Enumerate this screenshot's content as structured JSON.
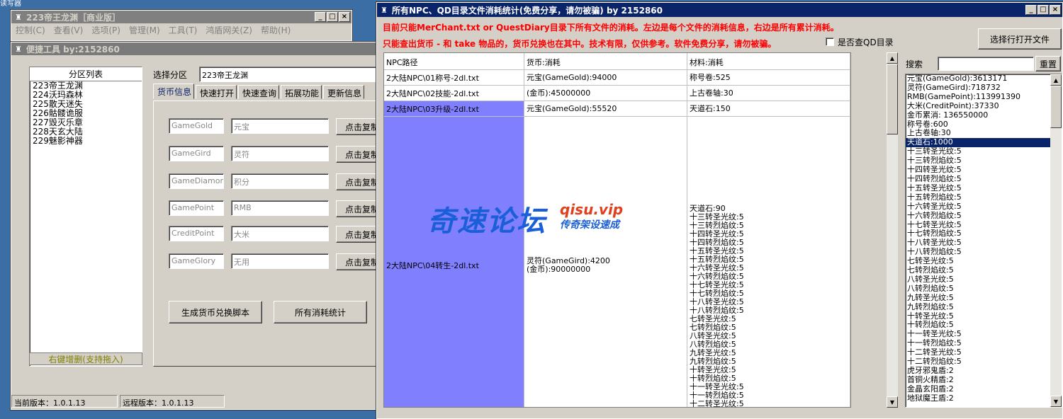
{
  "desktop": {
    "corner_text": "读写器"
  },
  "main_window": {
    "title": "223帝王龙渊［商业版］",
    "menu": [
      "控制(C)",
      "查看(V)",
      "选项(P)",
      "管理(M)",
      "工具(T)",
      "鸿盾网关(Z)",
      "帮助(H)"
    ]
  },
  "tool_window": {
    "title": "便捷工具   by:2152860",
    "partition_header": "分区列表",
    "partitions": [
      "223帝王龙渊",
      "224沃玛森林",
      "225散天迷失",
      "226骷髅诡服",
      "227毁灭乐章",
      "228天玄大陆",
      "229魅影神器"
    ],
    "partition_footer": "右键增删(支持拖入)",
    "select_label": "选择分区",
    "select_value": "223帝王龙渊",
    "tabs": [
      "货币信息",
      "快速打开",
      "快速查询",
      "拓展功能",
      "更新信息"
    ],
    "currencies": [
      {
        "code": "GameGold",
        "name": "元宝",
        "button": "点击复制"
      },
      {
        "code": "GameGird",
        "name": "灵符",
        "button": "点击复制"
      },
      {
        "code": "GameDiamond",
        "name": "积分",
        "button": "点击复制"
      },
      {
        "code": "GamePoint",
        "name": "RMB",
        "button": "点击复制"
      },
      {
        "code": "CreditPoint",
        "name": "大米",
        "button": "点击复制"
      },
      {
        "code": "GameGlory",
        "name": "无用",
        "button": "点击复制"
      }
    ],
    "gen_button": "生成货币兑换脚本",
    "stats_button": "所有消耗统计",
    "status_local": "当前版本：1.0.1.13",
    "status_remote": "远程版本：1.0.1.13"
  },
  "stats_window": {
    "title": "所有NPC、QD目录文件消耗统计(免费分享，请勿被骗)      by 2152860",
    "notice1": "目前只能MerChant.txt or QuestDiary目录下所有文件的消耗。左边是每个文件的消耗信息，右边是所有累计消耗。",
    "notice2": "只能查出货币 - 和 take 物品的，货币兑换也在其中。技术有限，仅供参考。软件免费分享，请勿被骗。",
    "checkbox_label": "是否查QD目录",
    "open_button": "选择行打开文件",
    "search_label": "搜索",
    "search_value": "",
    "reset_button": "重置",
    "columns": [
      "NPC路径",
      "货币:消耗",
      "材料:消耗"
    ],
    "rows": [
      {
        "path": "2大陆NPC\\01称号-2dl.txt",
        "currency": [
          "元宝(GameGold):94000"
        ],
        "material": [
          "称号卷:525"
        ]
      },
      {
        "path": "2大陆NPC\\02技能-2dl.txt",
        "currency": [
          "(金币):45000000"
        ],
        "material": [
          "上古卷轴:30"
        ]
      },
      {
        "path": "2大陆NPC\\03升级-2dl.txt",
        "currency": [
          "元宝(GameGold):55520"
        ],
        "material": [
          "天道石:150"
        ]
      },
      {
        "path": "2大陆NPC\\04转生-2dl.txt",
        "currency": [
          "灵符(GameGird):4200",
          "(金币):90000000"
        ],
        "material": [
          "天道石:90",
          "十三转圣光纹:5",
          "十三转烈焰纹:5",
          "十四转圣光纹:5",
          "十四转烈焰纹:5",
          "十五转圣光纹:5",
          "十五转烈焰纹:5",
          "十六转圣光纹:5",
          "十六转烈焰纹:5",
          "十七转圣光纹:5",
          "十七转烈焰纹:5",
          "十八转圣光纹:5",
          "十八转烈焰纹:5",
          "七转圣光纹:5",
          "七转烈焰纹:5",
          "八转圣光纹:5",
          "八转烈焰纹:5",
          "九转圣光纹:5",
          "九转烈焰纹:5",
          "十转圣光纹:5",
          "十转烈焰纹:5",
          "十一转圣光纹:5",
          "十一转烈焰纹:5",
          "十二转圣光纹:5"
        ]
      }
    ],
    "totals": [
      "元宝(GameGold):3613171",
      "灵符(GameGird):718732",
      "RMB(GamePoint):113991390",
      "大米(CreditPoint):37330",
      "金币累消: 136550000",
      "称号卷:600",
      "上古卷轴:30",
      "天道石:1000",
      "十三转圣光纹:5",
      "十三转烈焰纹:5",
      "十四转圣光纹:5",
      "十四转烈焰纹:5",
      "十五转圣光纹:5",
      "十五转烈焰纹:5",
      "十六转圣光纹:5",
      "十六转烈焰纹:5",
      "十七转圣光纹:5",
      "十七转烈焰纹:5",
      "十八转圣光纹:5",
      "十八转烈焰纹:5",
      "七转圣光纹:5",
      "七转烈焰纹:5",
      "八转圣光纹:5",
      "八转烈焰纹:5",
      "九转圣光纹:5",
      "九转烈焰纹:5",
      "十转圣光纹:5",
      "十转烈焰纹:5",
      "十一转圣光纹:5",
      "十一转烈焰纹:5",
      "十二转圣光纹:5",
      "十二转烈焰纹:5",
      "虎牙邪鬼盾:2",
      "首铜火精盾:2",
      "金晶玄阳盾:2",
      "地狱魔王盾:2"
    ],
    "selected_total": 7
  },
  "watermark": {
    "cn": "奇速论坛",
    "url": "qisu.vip",
    "slogan": "传奇架设速成"
  },
  "colors": {
    "title_active": "#0a246a",
    "notice": "#ff0000",
    "selected_row": "#8080ff",
    "face": "#d4d0c8"
  }
}
